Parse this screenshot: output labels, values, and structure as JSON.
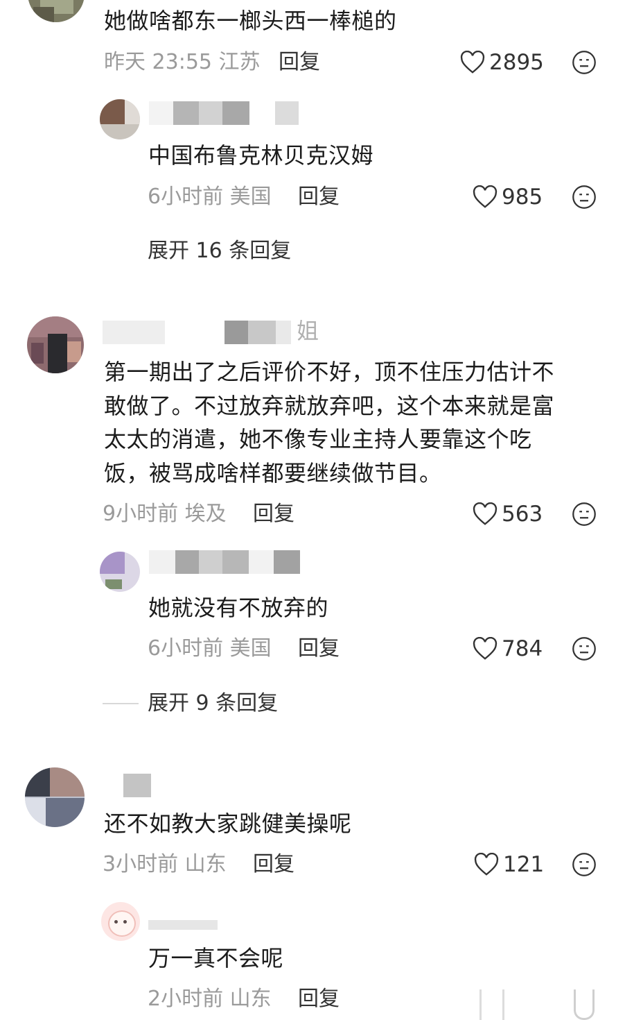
{
  "comments": [
    {
      "text": "她做啥都东一榔头西一棒槌的",
      "time": "昨天 23:55",
      "location": "江苏",
      "reply_label": "回复",
      "likes": "2895"
    },
    {
      "text": "中国布鲁克林贝克汉姆",
      "time": "6小时前",
      "location": "美国",
      "reply_label": "回复",
      "likes": "985"
    },
    {
      "username": "姐",
      "lines": [
        "第一期出了之后评价不好，顶不住压力估计不",
        "敢做了。不过放弃就放弃吧，这个本来就是富",
        "太太的消遣，她不像专业主持人要靠这个吃",
        "饭，被骂成啥样都要继续做节目。"
      ],
      "time": "9小时前",
      "location": "埃及",
      "reply_label": "回复",
      "likes": "563"
    },
    {
      "text": "她就没有不放弃的",
      "time": "6小时前",
      "location": "美国",
      "reply_label": "回复",
      "likes": "784"
    },
    {
      "text": "还不如教大家跳健美操呢",
      "time": "3小时前",
      "location": "山东",
      "reply_label": "回复",
      "likes": "121"
    },
    {
      "text": "万一真不会呢",
      "time": "2小时前",
      "location": "山东",
      "reply_label": "回复"
    }
  ],
  "expand": [
    "展开 16 条回复",
    "展开 9 条回复"
  ],
  "icons": {
    "like": "heart-outline-icon",
    "dislike": "neutral-face-icon"
  },
  "colors": {
    "meta": "#9a9a9a",
    "text": "#1b1b1b"
  }
}
